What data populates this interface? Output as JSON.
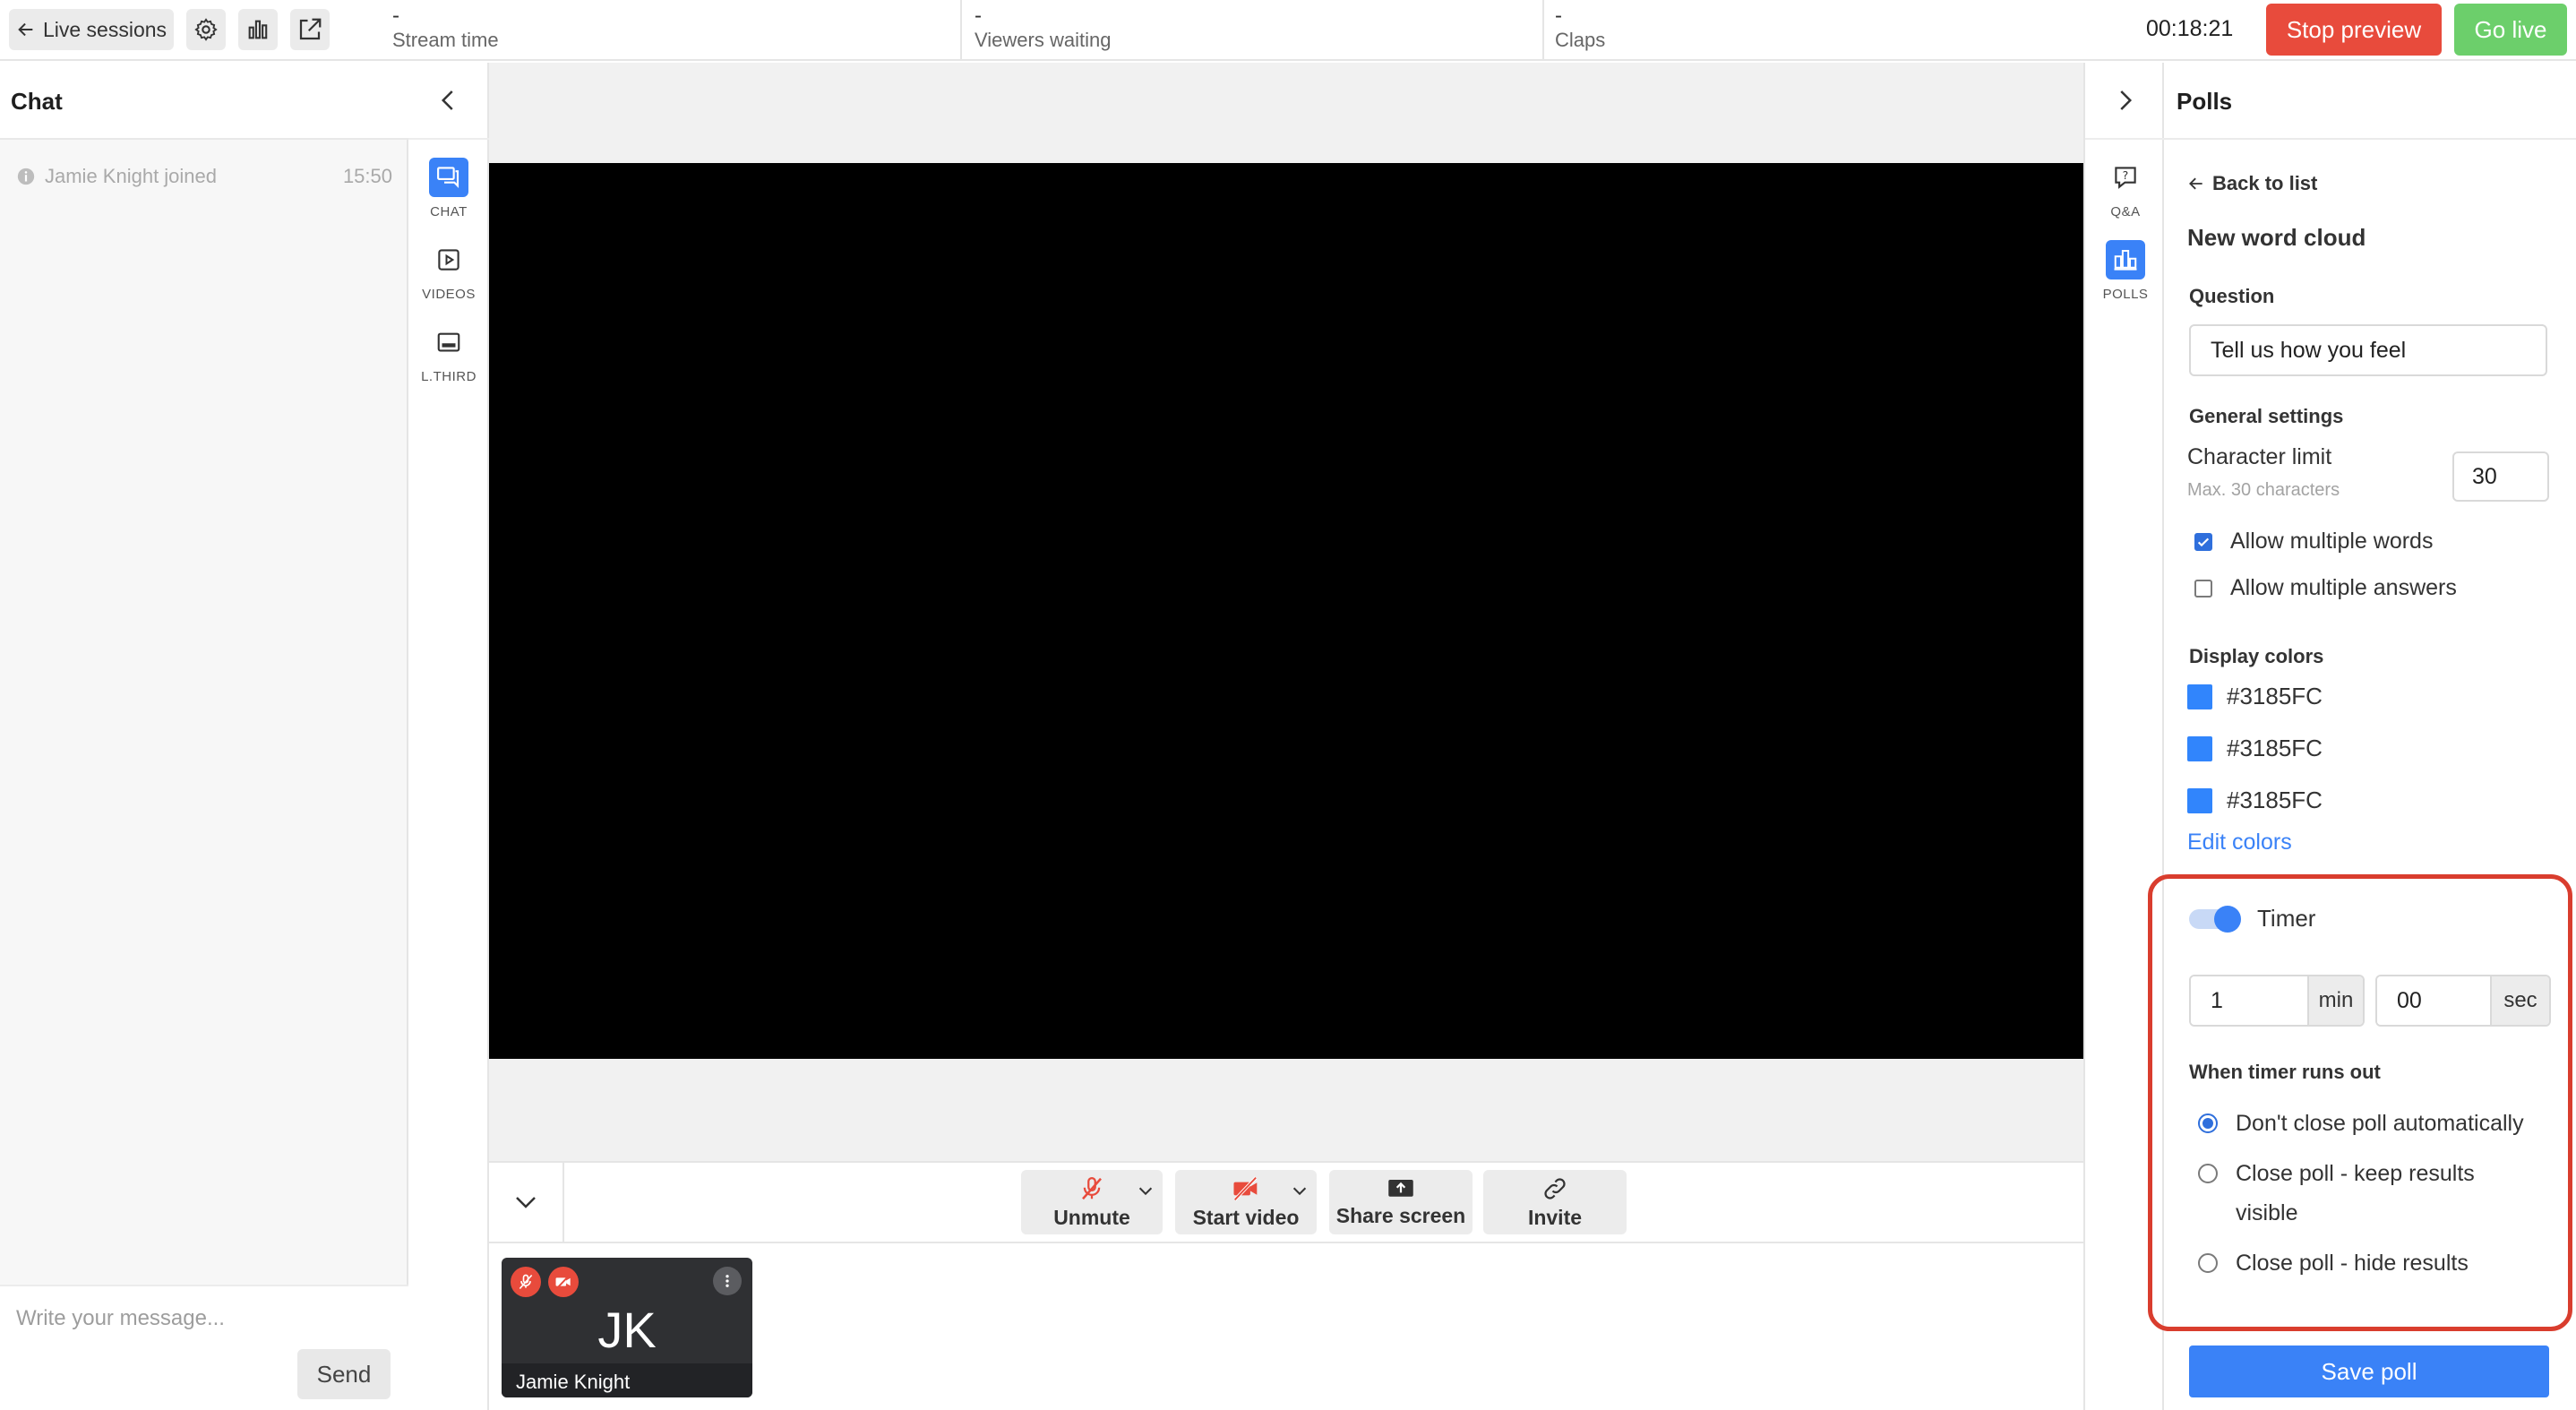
{
  "header": {
    "back_label": "Live sessions",
    "stats": [
      {
        "value": "-",
        "label": "Stream time"
      },
      {
        "value": "-",
        "label": "Viewers waiting"
      },
      {
        "value": "-",
        "label": "Claps"
      }
    ],
    "elapsed": "00:18:21",
    "stop_preview_label": "Stop preview",
    "go_live_label": "Go live",
    "colors": {
      "stop": "#e84b3c",
      "go_live": "#6ccf6b"
    }
  },
  "chat": {
    "title": "Chat",
    "messages": [
      {
        "text": "Jamie Knight joined",
        "time": "15:50",
        "icon": "info-icon"
      }
    ],
    "input_placeholder": "Write your message...",
    "send_label": "Send"
  },
  "left_rail": {
    "items": [
      {
        "label": "CHAT",
        "icon": "chat-icon",
        "active": true
      },
      {
        "label": "VIDEOS",
        "icon": "video-play-icon",
        "active": false
      },
      {
        "label": "L.THIRD",
        "icon": "lower-third-icon",
        "active": false
      }
    ]
  },
  "controls": {
    "buttons": [
      {
        "label": "Unmute",
        "icon": "mic-off-icon"
      },
      {
        "label": "Start video",
        "icon": "camera-off-icon"
      },
      {
        "label": "Share screen",
        "icon": "share-screen-icon"
      },
      {
        "label": "Invite",
        "icon": "link-icon"
      }
    ]
  },
  "participant": {
    "initials": "JK",
    "name": "Jamie Knight"
  },
  "right_rail": {
    "items": [
      {
        "label": "Q&A",
        "icon": "question-icon",
        "active": false
      },
      {
        "label": "POLLS",
        "icon": "polls-icon",
        "active": true
      }
    ]
  },
  "polls": {
    "title": "Polls",
    "back_label": "Back to list",
    "heading": "New word cloud",
    "question_label": "Question",
    "question_value": "Tell us how you feel",
    "general_settings_label": "General settings",
    "char_limit_label": "Character limit",
    "char_limit_hint": "Max. 30 characters",
    "char_limit_value": "30",
    "allow_multiple_words_label": "Allow multiple words",
    "allow_multiple_words_checked": true,
    "allow_multiple_answers_label": "Allow multiple answers",
    "allow_multiple_answers_checked": false,
    "display_colors_label": "Display colors",
    "colors": [
      "#3185FC",
      "#3185FC",
      "#3185FC"
    ],
    "edit_colors_label": "Edit colors",
    "timer_label": "Timer",
    "timer_enabled": true,
    "minutes_value": "1",
    "minutes_unit": "min",
    "seconds_value": "00",
    "seconds_unit": "sec",
    "timer_out_label": "When timer runs out",
    "timer_options": [
      {
        "label": "Don't close poll automatically",
        "selected": true
      },
      {
        "label": "Close poll - keep results visible",
        "selected": false
      },
      {
        "label": "Close poll - hide results",
        "selected": false
      }
    ],
    "save_label": "Save poll",
    "accent_color": "#3a82f7",
    "highlight_color": "#d93d2e"
  }
}
